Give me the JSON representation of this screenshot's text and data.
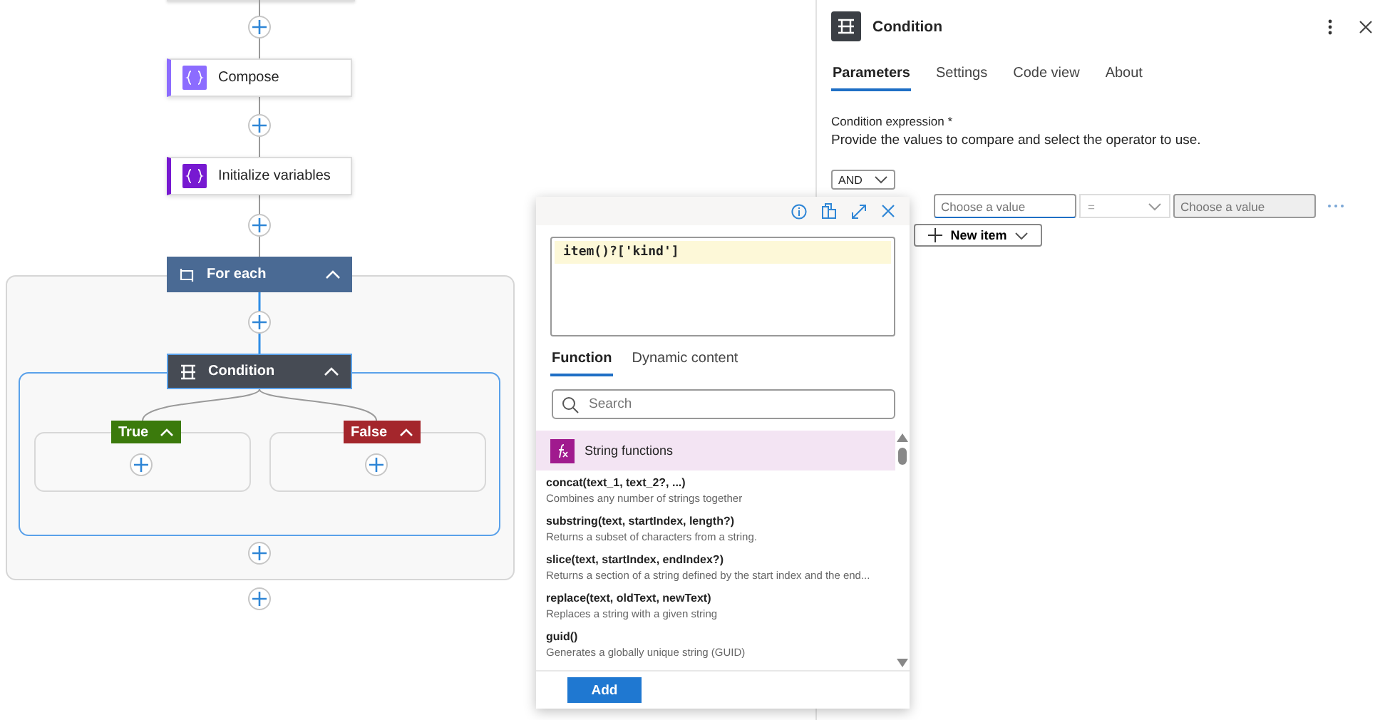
{
  "flow": {
    "nodes": [
      {
        "kind": "action",
        "title": "Compose",
        "color": "#8c6cff"
      },
      {
        "kind": "action",
        "title": "Initialize variables",
        "color": "#7719d1"
      },
      {
        "kind": "loop",
        "title": "For each"
      },
      {
        "kind": "condition",
        "title": "Condition",
        "selected": true
      }
    ],
    "branches": [
      {
        "label": "True",
        "color": "#3b7a0c"
      },
      {
        "label": "False",
        "color": "#a4262c"
      }
    ]
  },
  "panel": {
    "title": "Condition",
    "tabs": [
      {
        "label": "Parameters",
        "selected": true
      },
      {
        "label": "Settings",
        "selected": false
      },
      {
        "label": "Code view",
        "selected": false
      },
      {
        "label": "About",
        "selected": false
      }
    ],
    "field_label": "Condition expression *",
    "description": "Provide the values to compare and select the operator to use.",
    "group_operator": "AND",
    "left_placeholder": "Choose a value",
    "operator_placeholder": "=",
    "right_placeholder": "Choose a value",
    "new_item": "New item"
  },
  "popup": {
    "expression": "item()?['kind']",
    "tabs": [
      {
        "label": "Function",
        "selected": true
      },
      {
        "label": "Dynamic content",
        "selected": false
      }
    ],
    "search_placeholder": "Search",
    "category": "String functions",
    "functions": [
      {
        "signature": "concat(text_1, text_2?, ...)",
        "description": "Combines any number of strings together"
      },
      {
        "signature": "substring(text, startIndex, length?)",
        "description": "Returns a subset of characters from a string."
      },
      {
        "signature": "slice(text, startIndex, endIndex?)",
        "description": "Returns a section of a string defined by the start index and the end..."
      },
      {
        "signature": "replace(text, oldText, newText)",
        "description": "Replaces a string with a given string"
      },
      {
        "signature": "guid()",
        "description": "Generates a globally unique string (GUID)"
      }
    ],
    "add_button": "Add"
  }
}
